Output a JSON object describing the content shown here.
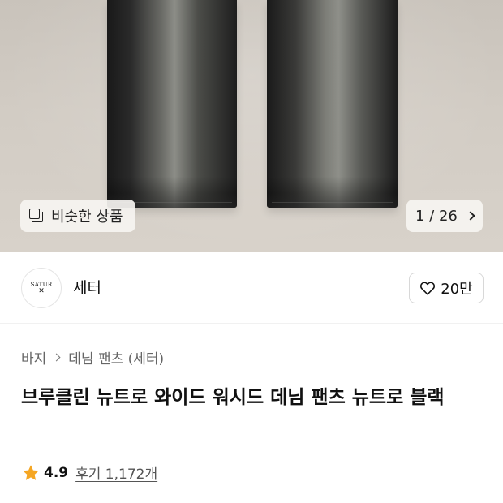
{
  "hero": {
    "similar_label": "비슷한 상품",
    "image_counter": "1 / 26",
    "icons": [
      "duplicate-icon",
      "chevron-right-icon"
    ]
  },
  "brand": {
    "name": "세터",
    "logo_text": "SATUR",
    "logo_mark": "✕",
    "like_count": "20만",
    "icons": [
      "heart-outline-icon"
    ]
  },
  "breadcrumb": {
    "category": "바지",
    "subcategory": "데님 팬츠 (세터)"
  },
  "product": {
    "title": "브루클린 뉴트로 와이드 워시드 데님 팬츠 뉴트로 블랙"
  },
  "rating": {
    "score": "4.9",
    "review_label": "후기 1,172개",
    "star_color": "#f5a623"
  }
}
